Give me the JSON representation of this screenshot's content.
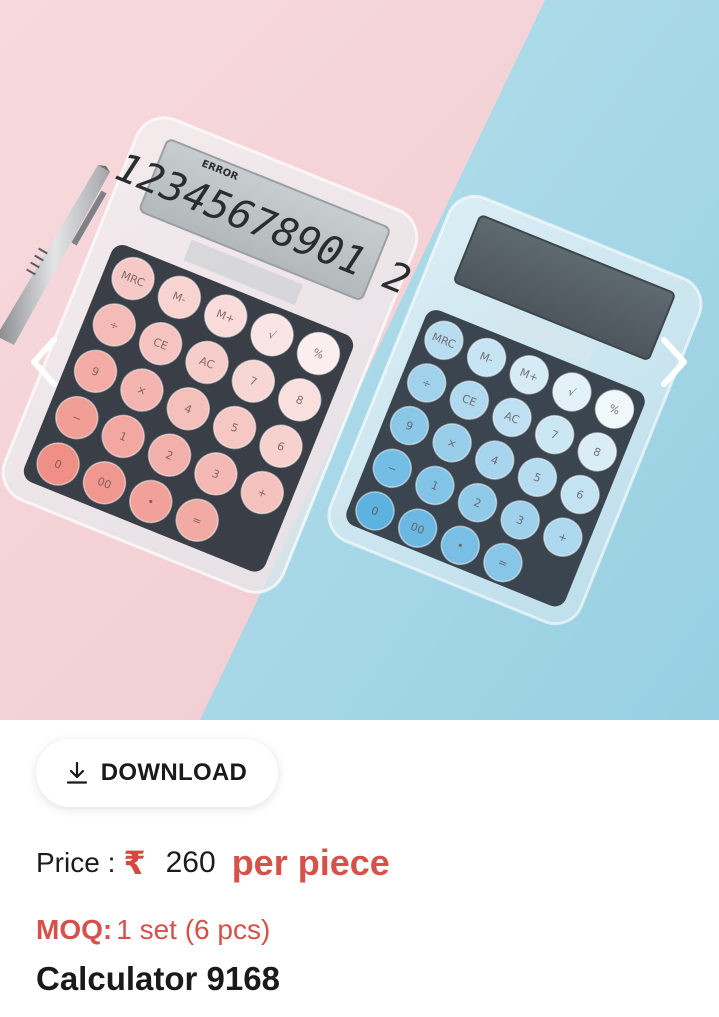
{
  "product_image": {
    "description_icon": "calculator-product-photo",
    "colors": {
      "pink_background": "#f5d3d8",
      "blue_background": "#a9d8e6",
      "pink_keys": "#ef8f86",
      "blue_keys": "#5db2e0"
    },
    "pink_calculator_display": "12345678901 2",
    "pink_calculator_error": "ERROR",
    "pink_keys": [
      "MRC",
      "M-",
      "M+",
      "√",
      "%",
      "÷",
      "CE",
      "AC",
      "7",
      "8",
      "9",
      "×",
      "4",
      "5",
      "6",
      "−",
      "1",
      "2",
      "3",
      "+",
      "0",
      "00",
      "•",
      "="
    ],
    "blue_keys": [
      "MRC",
      "M-",
      "M+",
      "√",
      "%",
      "÷",
      "CE",
      "AC",
      "7",
      "8",
      "9",
      "×",
      "4",
      "5",
      "6",
      "−",
      "1",
      "2",
      "3",
      "+",
      "0",
      "00",
      "•",
      "="
    ]
  },
  "nav": {
    "prev_icon": "chevron-left-icon",
    "next_icon": "chevron-right-icon"
  },
  "download": {
    "icon": "download-icon",
    "label": "DOWNLOAD"
  },
  "price": {
    "label": "Price :",
    "currency_symbol": "₹",
    "value": "260",
    "unit": "per piece"
  },
  "moq": {
    "label": "MOQ:",
    "value": "1 set (6 pcs)"
  },
  "product": {
    "title": "Calculator 9168"
  }
}
